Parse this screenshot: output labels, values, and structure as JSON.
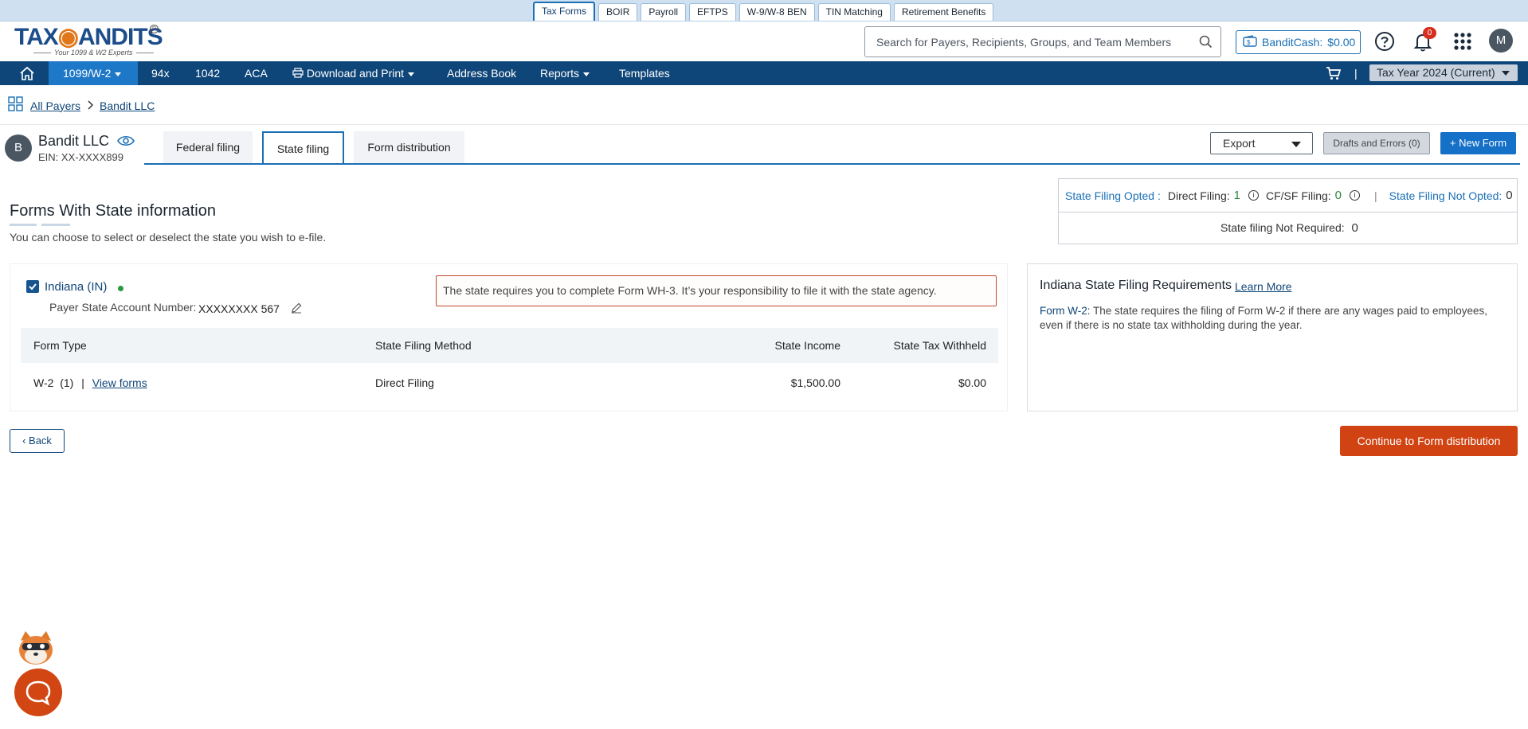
{
  "product_tabs": [
    "Tax Forms",
    "BOIR",
    "Payroll",
    "EFTPS",
    "W-9/W-8 BEN",
    "TIN Matching",
    "Retirement Benefits"
  ],
  "logo": {
    "text_left": "TAX",
    "text_right": "ANDITS",
    "tagline": "Your 1099 & W2 Experts",
    "registered": "R"
  },
  "search": {
    "placeholder": "Search for Payers, Recipients, Groups, and Team Members"
  },
  "bandit_cash": {
    "label": "BanditCash:",
    "amount": "$0.00"
  },
  "notifications": {
    "count": "0"
  },
  "user": {
    "initial": "M"
  },
  "nav": {
    "items": [
      "1099/W-2",
      "94x",
      "1042",
      "ACA",
      "Download and Print",
      "Address Book",
      "Reports",
      "Templates"
    ],
    "separator": "|",
    "tax_year": "Tax Year 2024 (Current)"
  },
  "breadcrumb": {
    "root": "All Payers",
    "current": "Bandit LLC"
  },
  "payer": {
    "initial": "B",
    "name": "Bandit LLC",
    "ein": "EIN: XX-XXXX899"
  },
  "filing_tabs": [
    "Federal filing",
    "State filing",
    "Form distribution"
  ],
  "actions": {
    "export": "Export",
    "drafts": "Drafts and Errors (0)",
    "new_form": "New Form"
  },
  "summary": {
    "opted_label": "State Filing Opted :",
    "direct_label": "Direct Filing:",
    "direct_val": "1",
    "cfsf_label": "CF/SF Filing:",
    "cfsf_val": "0",
    "sep": "|",
    "not_opted_label": "State Filing Not Opted:",
    "not_opted_val": "0",
    "not_required_label": "State filing Not Required:",
    "not_required_val": "0"
  },
  "section": {
    "title": "Forms With State information",
    "subtitle": "You can choose to select or deselect the state you wish to e-file."
  },
  "state": {
    "name": "Indiana (IN)",
    "account_label": "Payer State Account Number:",
    "account_value": "XXXXXXXX 567",
    "notice": "The state requires you to complete Form WH-3. It’s your responsibility to file it with the state agency.",
    "columns": [
      "Form Type",
      "State Filing Method",
      "State Income",
      "State Tax Withheld"
    ],
    "rows": [
      {
        "form": "W-2  (1)",
        "sep": "|",
        "link": "View forms",
        "method": "Direct Filing",
        "income": "$1,500.00",
        "withheld": "$0.00"
      }
    ]
  },
  "requirements": {
    "title": "Indiana State Filing Requirements",
    "learn_more": "Learn More",
    "form_label": "Form W-2:",
    "text": "The state requires the filing of Form W-2 if there are any wages paid to employees, even if there is no state tax withholding during the year."
  },
  "buttons": {
    "back": "Back",
    "continue": "Continue to Form distribution"
  },
  "colors": {
    "nav": "#0f4679",
    "accent": "#1a6fb5",
    "continue": "#d14312"
  }
}
